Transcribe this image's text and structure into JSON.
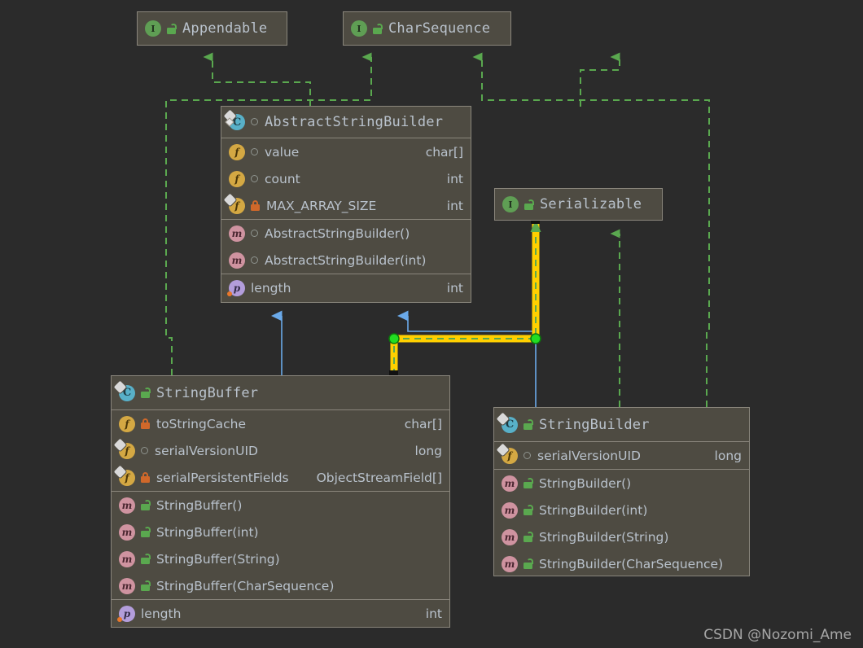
{
  "diagram": {
    "title": "Java String classes UML diagram",
    "background": "#2b2b2b",
    "node_fill": "#4e4b42",
    "node_border": "#8a867c",
    "text_color": "#b9c2cc",
    "inherit_color": "#5aa84f",
    "extend_color": "#4a90d9",
    "selection_color": "#ffd000"
  },
  "nodes": {
    "appendable": {
      "kind": "interface",
      "name": "Appendable",
      "icon": "interface-icon",
      "visibility": "public"
    },
    "charsequence": {
      "kind": "interface",
      "name": "CharSequence",
      "icon": "interface-icon",
      "visibility": "public"
    },
    "serializable": {
      "kind": "interface",
      "name": "Serializable",
      "icon": "interface-icon",
      "visibility": "public"
    },
    "abstractstringbuilder": {
      "kind": "class",
      "name": "AbstractStringBuilder",
      "icon": "abstract-class-icon",
      "visibility": "package",
      "fields": [
        {
          "icon": "field-icon",
          "visibility": "package",
          "name": "value",
          "type": "char[]",
          "static": false
        },
        {
          "icon": "field-icon",
          "visibility": "package",
          "name": "count",
          "type": "int",
          "static": false
        },
        {
          "icon": "field-icon",
          "visibility": "private",
          "name": "MAX_ARRAY_SIZE",
          "type": "int",
          "static": true
        }
      ],
      "methods": [
        {
          "icon": "method-icon",
          "visibility": "package",
          "name": "AbstractStringBuilder()",
          "type": ""
        },
        {
          "icon": "method-icon",
          "visibility": "package",
          "name": "AbstractStringBuilder(int)",
          "type": ""
        }
      ],
      "properties": [
        {
          "icon": "property-icon",
          "visibility": "none",
          "name": "length",
          "type": "int"
        }
      ]
    },
    "stringbuffer": {
      "kind": "class",
      "name": "StringBuffer",
      "icon": "final-class-icon",
      "visibility": "public",
      "fields": [
        {
          "icon": "field-icon",
          "visibility": "private",
          "name": "toStringCache",
          "type": "char[]",
          "static": false
        },
        {
          "icon": "field-icon",
          "visibility": "package",
          "name": "serialVersionUID",
          "type": "long",
          "static": true
        },
        {
          "icon": "field-icon",
          "visibility": "private",
          "name": "serialPersistentFields",
          "type": "ObjectStreamField[]",
          "static": true
        }
      ],
      "methods": [
        {
          "icon": "method-icon",
          "visibility": "public",
          "name": "StringBuffer()",
          "type": ""
        },
        {
          "icon": "method-icon",
          "visibility": "public",
          "name": "StringBuffer(int)",
          "type": ""
        },
        {
          "icon": "method-icon",
          "visibility": "public",
          "name": "StringBuffer(String)",
          "type": ""
        },
        {
          "icon": "method-icon",
          "visibility": "public",
          "name": "StringBuffer(CharSequence)",
          "type": ""
        }
      ],
      "properties": [
        {
          "icon": "property-icon",
          "visibility": "none",
          "name": "length",
          "type": "int"
        }
      ]
    },
    "stringbuilder": {
      "kind": "class",
      "name": "StringBuilder",
      "icon": "final-class-icon",
      "visibility": "public",
      "fields": [
        {
          "icon": "field-icon",
          "visibility": "package",
          "name": "serialVersionUID",
          "type": "long",
          "static": true
        }
      ],
      "methods": [
        {
          "icon": "method-icon",
          "visibility": "public",
          "name": "StringBuilder()",
          "type": ""
        },
        {
          "icon": "method-icon",
          "visibility": "public",
          "name": "StringBuilder(int)",
          "type": ""
        },
        {
          "icon": "method-icon",
          "visibility": "public",
          "name": "StringBuilder(String)",
          "type": ""
        },
        {
          "icon": "method-icon",
          "visibility": "public",
          "name": "StringBuilder(CharSequence)",
          "type": ""
        }
      ],
      "properties": []
    }
  },
  "relations": [
    {
      "from": "AbstractStringBuilder",
      "to": "Appendable",
      "type": "implements",
      "selected": false
    },
    {
      "from": "AbstractStringBuilder",
      "to": "CharSequence",
      "type": "implements",
      "selected": false
    },
    {
      "from": "StringBuffer",
      "to": "Appendable",
      "type": "implements",
      "selected": false
    },
    {
      "from": "StringBuilder",
      "to": "CharSequence",
      "type": "implements",
      "selected": false
    },
    {
      "from": "StringBuffer",
      "to": "Serializable",
      "type": "implements",
      "selected": true
    },
    {
      "from": "StringBuilder",
      "to": "Serializable",
      "type": "implements",
      "selected": false
    },
    {
      "from": "StringBuffer",
      "to": "AbstractStringBuilder",
      "type": "extends",
      "selected": false
    },
    {
      "from": "StringBuilder",
      "to": "AbstractStringBuilder",
      "type": "extends",
      "selected": false
    }
  ],
  "watermark": "CSDN @Nozomi_Ame"
}
